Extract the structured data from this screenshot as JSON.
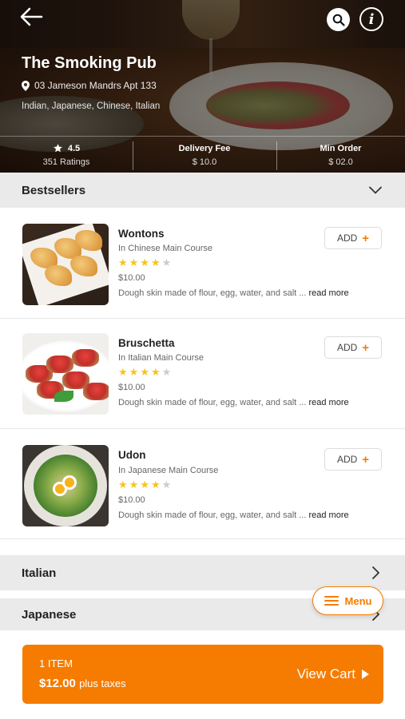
{
  "restaurant": {
    "name": "The Smoking Pub",
    "address": "03 Jameson Mandrs Apt 133",
    "cuisines": "Indian, Japanese, Chinese, Italian"
  },
  "stats": {
    "rating": "4.5",
    "ratings_count": "351 Ratings",
    "delivery_label": "Delivery Fee",
    "delivery_value": "$ 10.0",
    "min_order_label": "Min Order",
    "min_order_value": "$ 02.0"
  },
  "sections": {
    "bestsellers": "Bestsellers",
    "italian": "Italian",
    "japanese": "Japanese"
  },
  "items": [
    {
      "name": "Wontons",
      "category": "In Chinese Main Course",
      "rating": 4,
      "price": "$10.00",
      "description": "Dough skin made of flour, egg, water, and salt ...",
      "read_more": "read more",
      "add_label": "ADD",
      "add_plus": "+"
    },
    {
      "name": "Bruschetta",
      "category": "In Italian Main Course",
      "rating": 4,
      "price": "$10.00",
      "description": "Dough skin made of flour, egg, water, and salt ...",
      "read_more": "read more",
      "add_label": "ADD",
      "add_plus": "+"
    },
    {
      "name": "Udon",
      "category": "In Japanese Main Course",
      "rating": 4,
      "price": "$10.00",
      "description": "Dough skin made of flour, egg, water, and salt ...",
      "read_more": "read more",
      "add_label": "ADD",
      "add_plus": "+"
    }
  ],
  "menu_fab": {
    "label": "Menu"
  },
  "cart": {
    "count": "1 ITEM",
    "total": "$12.00",
    "tax_note": "plus taxes",
    "view_label": "View Cart"
  },
  "colors": {
    "accent": "#f57c00",
    "star": "#f5c518",
    "section_bg": "#eaeaea"
  },
  "icons": [
    "back-arrow-icon",
    "search-icon",
    "info-icon",
    "location-pin-icon",
    "star-icon",
    "chevron-down-icon",
    "chevron-right-icon",
    "hamburger-icon",
    "play-arrow-icon"
  ]
}
